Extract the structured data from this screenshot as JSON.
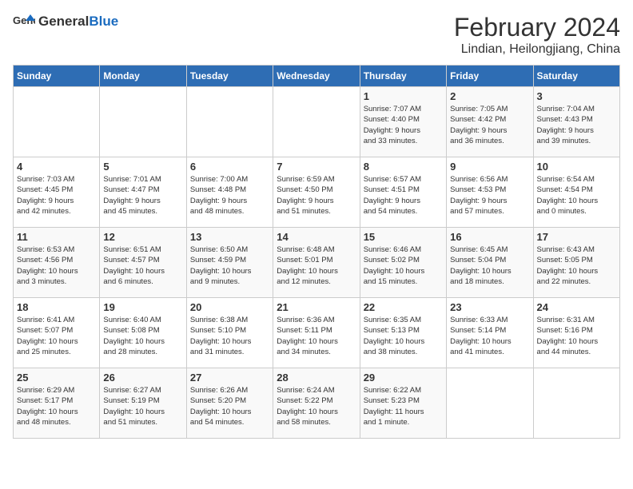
{
  "logo": {
    "general": "General",
    "blue": "Blue"
  },
  "title": "February 2024",
  "subtitle": "Lindian, Heilongjiang, China",
  "weekdays": [
    "Sunday",
    "Monday",
    "Tuesday",
    "Wednesday",
    "Thursday",
    "Friday",
    "Saturday"
  ],
  "weeks": [
    [
      {
        "day": "",
        "info": ""
      },
      {
        "day": "",
        "info": ""
      },
      {
        "day": "",
        "info": ""
      },
      {
        "day": "",
        "info": ""
      },
      {
        "day": "1",
        "info": "Sunrise: 7:07 AM\nSunset: 4:40 PM\nDaylight: 9 hours\nand 33 minutes."
      },
      {
        "day": "2",
        "info": "Sunrise: 7:05 AM\nSunset: 4:42 PM\nDaylight: 9 hours\nand 36 minutes."
      },
      {
        "day": "3",
        "info": "Sunrise: 7:04 AM\nSunset: 4:43 PM\nDaylight: 9 hours\nand 39 minutes."
      }
    ],
    [
      {
        "day": "4",
        "info": "Sunrise: 7:03 AM\nSunset: 4:45 PM\nDaylight: 9 hours\nand 42 minutes."
      },
      {
        "day": "5",
        "info": "Sunrise: 7:01 AM\nSunset: 4:47 PM\nDaylight: 9 hours\nand 45 minutes."
      },
      {
        "day": "6",
        "info": "Sunrise: 7:00 AM\nSunset: 4:48 PM\nDaylight: 9 hours\nand 48 minutes."
      },
      {
        "day": "7",
        "info": "Sunrise: 6:59 AM\nSunset: 4:50 PM\nDaylight: 9 hours\nand 51 minutes."
      },
      {
        "day": "8",
        "info": "Sunrise: 6:57 AM\nSunset: 4:51 PM\nDaylight: 9 hours\nand 54 minutes."
      },
      {
        "day": "9",
        "info": "Sunrise: 6:56 AM\nSunset: 4:53 PM\nDaylight: 9 hours\nand 57 minutes."
      },
      {
        "day": "10",
        "info": "Sunrise: 6:54 AM\nSunset: 4:54 PM\nDaylight: 10 hours\nand 0 minutes."
      }
    ],
    [
      {
        "day": "11",
        "info": "Sunrise: 6:53 AM\nSunset: 4:56 PM\nDaylight: 10 hours\nand 3 minutes."
      },
      {
        "day": "12",
        "info": "Sunrise: 6:51 AM\nSunset: 4:57 PM\nDaylight: 10 hours\nand 6 minutes."
      },
      {
        "day": "13",
        "info": "Sunrise: 6:50 AM\nSunset: 4:59 PM\nDaylight: 10 hours\nand 9 minutes."
      },
      {
        "day": "14",
        "info": "Sunrise: 6:48 AM\nSunset: 5:01 PM\nDaylight: 10 hours\nand 12 minutes."
      },
      {
        "day": "15",
        "info": "Sunrise: 6:46 AM\nSunset: 5:02 PM\nDaylight: 10 hours\nand 15 minutes."
      },
      {
        "day": "16",
        "info": "Sunrise: 6:45 AM\nSunset: 5:04 PM\nDaylight: 10 hours\nand 18 minutes."
      },
      {
        "day": "17",
        "info": "Sunrise: 6:43 AM\nSunset: 5:05 PM\nDaylight: 10 hours\nand 22 minutes."
      }
    ],
    [
      {
        "day": "18",
        "info": "Sunrise: 6:41 AM\nSunset: 5:07 PM\nDaylight: 10 hours\nand 25 minutes."
      },
      {
        "day": "19",
        "info": "Sunrise: 6:40 AM\nSunset: 5:08 PM\nDaylight: 10 hours\nand 28 minutes."
      },
      {
        "day": "20",
        "info": "Sunrise: 6:38 AM\nSunset: 5:10 PM\nDaylight: 10 hours\nand 31 minutes."
      },
      {
        "day": "21",
        "info": "Sunrise: 6:36 AM\nSunset: 5:11 PM\nDaylight: 10 hours\nand 34 minutes."
      },
      {
        "day": "22",
        "info": "Sunrise: 6:35 AM\nSunset: 5:13 PM\nDaylight: 10 hours\nand 38 minutes."
      },
      {
        "day": "23",
        "info": "Sunrise: 6:33 AM\nSunset: 5:14 PM\nDaylight: 10 hours\nand 41 minutes."
      },
      {
        "day": "24",
        "info": "Sunrise: 6:31 AM\nSunset: 5:16 PM\nDaylight: 10 hours\nand 44 minutes."
      }
    ],
    [
      {
        "day": "25",
        "info": "Sunrise: 6:29 AM\nSunset: 5:17 PM\nDaylight: 10 hours\nand 48 minutes."
      },
      {
        "day": "26",
        "info": "Sunrise: 6:27 AM\nSunset: 5:19 PM\nDaylight: 10 hours\nand 51 minutes."
      },
      {
        "day": "27",
        "info": "Sunrise: 6:26 AM\nSunset: 5:20 PM\nDaylight: 10 hours\nand 54 minutes."
      },
      {
        "day": "28",
        "info": "Sunrise: 6:24 AM\nSunset: 5:22 PM\nDaylight: 10 hours\nand 58 minutes."
      },
      {
        "day": "29",
        "info": "Sunrise: 6:22 AM\nSunset: 5:23 PM\nDaylight: 11 hours\nand 1 minute."
      },
      {
        "day": "",
        "info": ""
      },
      {
        "day": "",
        "info": ""
      }
    ]
  ]
}
